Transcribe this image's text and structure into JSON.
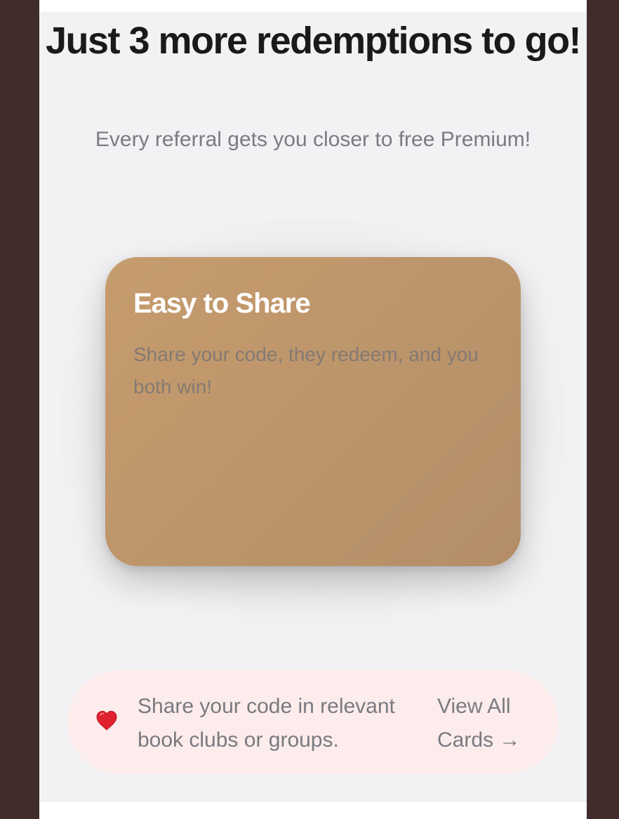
{
  "header": {
    "title": "Just 3 more redemptions to go!",
    "subtitle": "Every referral gets you closer to free Premium!"
  },
  "card": {
    "title": "Easy to Share",
    "description": "Share your code, they redeem, and you both win!"
  },
  "tip": {
    "icon": "heart-icon",
    "text": "Share your code in relevant book clubs or groups.",
    "link_label": "View All Cards →"
  },
  "colors": {
    "background": "#402d2b",
    "panel": "#f2f2f4",
    "card": "#c69c6e",
    "tip_background": "#fcecec",
    "heart": "#e0212e"
  }
}
